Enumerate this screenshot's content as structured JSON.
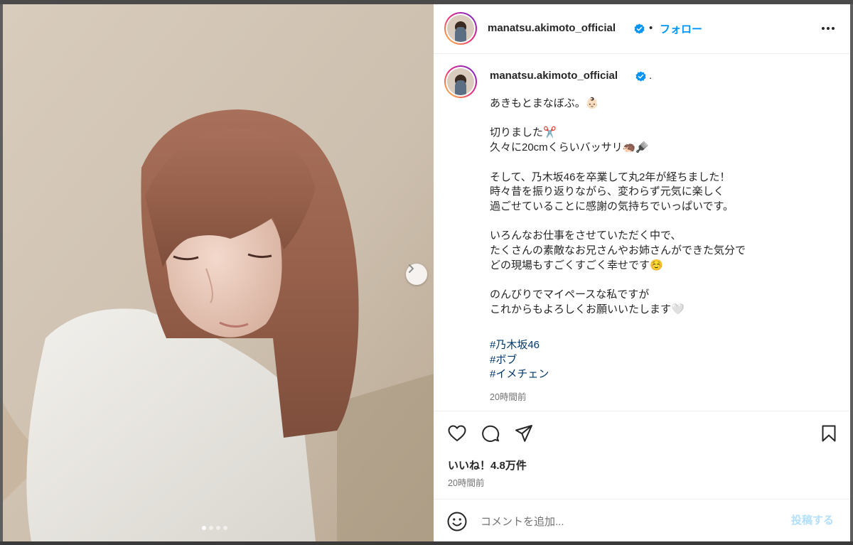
{
  "post": {
    "username": "manatsu.akimoto_official",
    "follow_separator": "•",
    "follow_label": "フォロー",
    "caption_separator": ".",
    "caption": "あきもとまなぼぶ。👶🏻\n\n切りました✂️\n久々に20cmくらいバッサリ🦔🪮\n\nそして、乃木坂46を卒業して丸2年が経ちました！\n時々昔を振り返りながら、変わらず元気に楽しく\n過ごせていることに感謝の気持ちでいっぱいです。\n\nいろんなお仕事をさせていただく中で、\nたくさんの素敵なお兄さんやお姉さんができた気分で\nどの現場もすごくすごく幸せです☺️\n\nのんびりでマイペースな私ですが\nこれからもよろしくお願いいたします🤍",
    "hashtags": [
      "#乃木坂46",
      "#ボブ",
      "#イメチェン"
    ],
    "caption_time": "20時間前",
    "likes": "いいね！4.8万件",
    "post_time": "20時間前"
  },
  "comment": {
    "placeholder": "コメントを追加...",
    "post_label": "投稿する"
  },
  "carousel": {
    "slide_count": 4,
    "active_index": 0
  },
  "icons": {
    "more": "more-options-icon",
    "like": "heart-icon",
    "comment": "comment-icon",
    "share": "share-icon",
    "save": "bookmark-icon",
    "next": "chevron-right-icon",
    "emoji": "emoji-icon",
    "verified": "verified-badge-icon"
  },
  "colors": {
    "accent": "#0095f6",
    "hashtag": "#00376b",
    "muted": "#737373",
    "post_disabled": "#b2dffc"
  }
}
